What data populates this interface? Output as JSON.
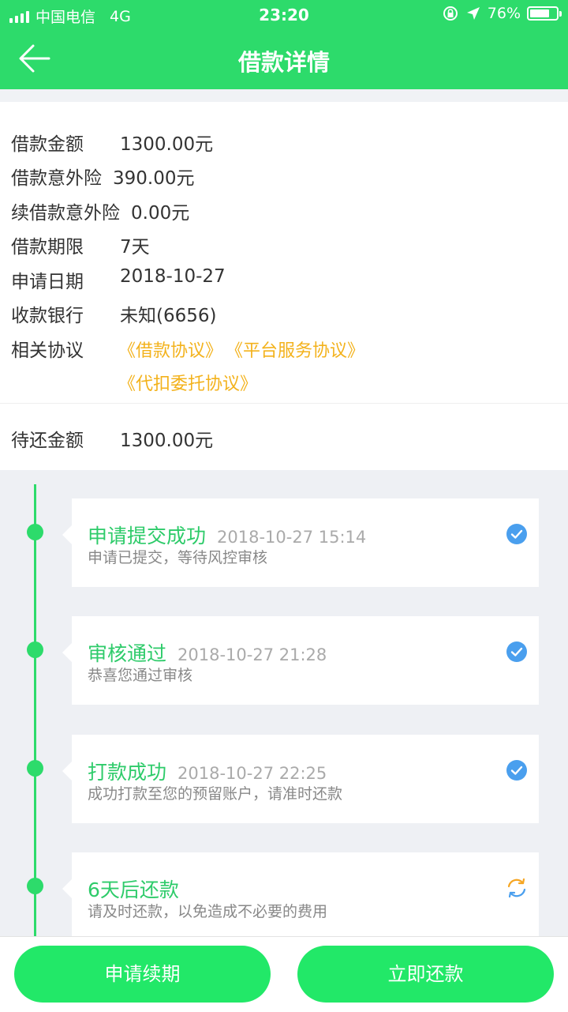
{
  "status_bar": {
    "carrier": "中国电信",
    "network": "4G",
    "time": "23:20",
    "battery_text": "76%",
    "battery_level": 0.76
  },
  "header": {
    "title": "借款详情"
  },
  "details": [
    {
      "label": "借款金额",
      "value": "1300.00元"
    },
    {
      "label": "借款意外险",
      "value": "390.00元"
    },
    {
      "label": "续借款意外险",
      "value": "0.00元"
    },
    {
      "label": "借款期限",
      "value": "7天"
    },
    {
      "label": "申请日期",
      "value": "2018-10-27"
    },
    {
      "label": "收款银行",
      "value": "未知(6656)"
    }
  ],
  "agreements": {
    "label": "相关协议",
    "items": [
      "《借款协议》",
      "《平台服务协议》",
      "《代扣委托协议》"
    ]
  },
  "pending": {
    "label": "待还金额",
    "value": "1300.00元"
  },
  "timeline": [
    {
      "title": "申请提交成功",
      "datetime": "2018-10-27 15:14",
      "desc": "申请已提交，等待风控审核",
      "status": "done"
    },
    {
      "title": "审核通过",
      "datetime": "2018-10-27 21:28",
      "desc": "恭喜您通过审核",
      "status": "done"
    },
    {
      "title": "打款成功",
      "datetime": "2018-10-27 22:25",
      "desc": "成功打款至您的预留账户，请准时还款",
      "status": "done"
    },
    {
      "title": "6天后还款",
      "datetime": "",
      "desc": "请及时还款，以免造成不必要的费用",
      "status": "pending"
    }
  ],
  "buttons": {
    "renew": "申请续期",
    "repay": "立即还款"
  },
  "colors": {
    "brand_green": "#2ddb6b",
    "button_green": "#22e868",
    "agreement_link": "#f3b21c",
    "check_blue": "#4a9fee",
    "pending_orange": "#f6a623",
    "pending_blue": "#4a9fee"
  },
  "icons": [
    "back-arrow-icon",
    "signal-icon",
    "lock-rotation-icon",
    "location-arrow-icon",
    "battery-icon",
    "check-circle-icon",
    "refresh-icon"
  ]
}
